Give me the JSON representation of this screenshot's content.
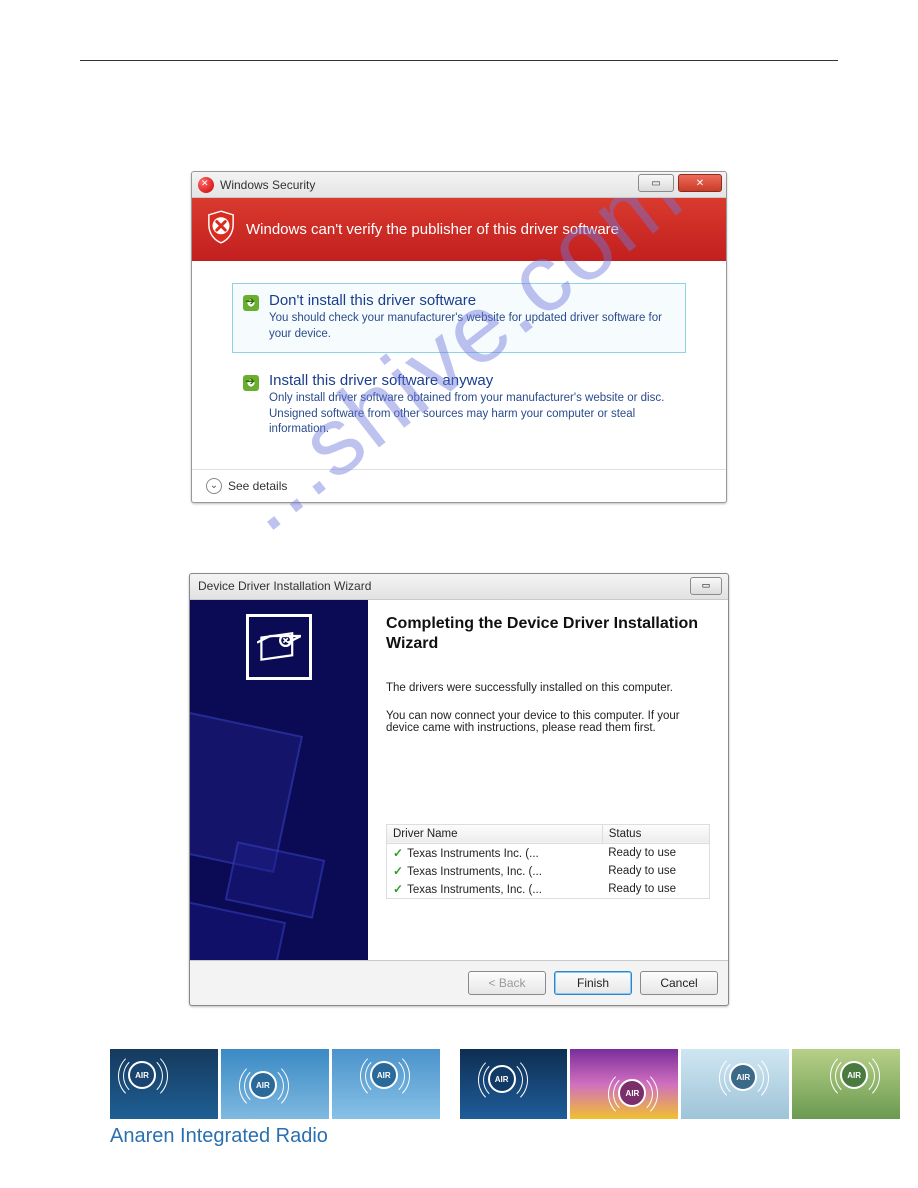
{
  "watermark_text": "...shive.com",
  "security_dialog": {
    "title": "Windows Security",
    "banner": "Windows can't verify the publisher of this driver software",
    "option1": {
      "title": "Don't install this driver software",
      "desc": "You should check your manufacturer's website for updated driver software for your device."
    },
    "option2": {
      "title": "Install this driver software anyway",
      "desc": "Only install driver software obtained from your manufacturer's website or disc. Unsigned software from other sources may harm your computer or steal information."
    },
    "see_details": "See details"
  },
  "wizard_dialog": {
    "title": "Device Driver Installation Wizard",
    "heading": "Completing the Device Driver Installation Wizard",
    "p1": "The drivers were successfully installed on this computer.",
    "p2": "You can now connect your device to this computer. If your device came with instructions, please read them first.",
    "columns": {
      "name": "Driver Name",
      "status": "Status"
    },
    "rows": [
      {
        "name": "Texas Instruments Inc. (...",
        "status": "Ready to use"
      },
      {
        "name": "Texas Instruments, Inc. (...",
        "status": "Ready to use"
      },
      {
        "name": "Texas Instruments, Inc. (...",
        "status": "Ready to use"
      }
    ],
    "buttons": {
      "back": "< Back",
      "finish": "Finish",
      "cancel": "Cancel"
    }
  },
  "footer": {
    "air_label": "AIR",
    "brand": "Anaren Integrated Radio"
  }
}
